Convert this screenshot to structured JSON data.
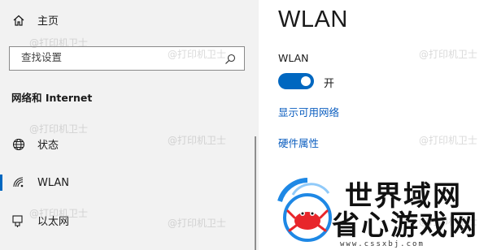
{
  "sidebar": {
    "home_label": "主页",
    "search_placeholder": "查找设置",
    "section_title": "网络和 Internet",
    "items": [
      {
        "label": "状态",
        "icon": "globe-icon"
      },
      {
        "label": "WLAN",
        "icon": "wifi-icon",
        "active": true
      },
      {
        "label": "以太网",
        "icon": "ethernet-icon"
      }
    ]
  },
  "main": {
    "title": "WLAN",
    "toggle_label": "WLAN",
    "toggle_state": "开",
    "toggle_on": true,
    "link_networks": "显示可用网络",
    "link_hardware": "硬件属性"
  },
  "watermark": "@打印机卫士",
  "logo": {
    "text_main": "省心游戏网",
    "text_top": "世界域网",
    "url": "www.cssxbj.com"
  },
  "colors": {
    "accent": "#0067c0",
    "link": "#0a5dbf",
    "sidebar_bg": "#f2f2f2",
    "logo_red": "#e8262b",
    "logo_blue": "#1e88e5"
  }
}
